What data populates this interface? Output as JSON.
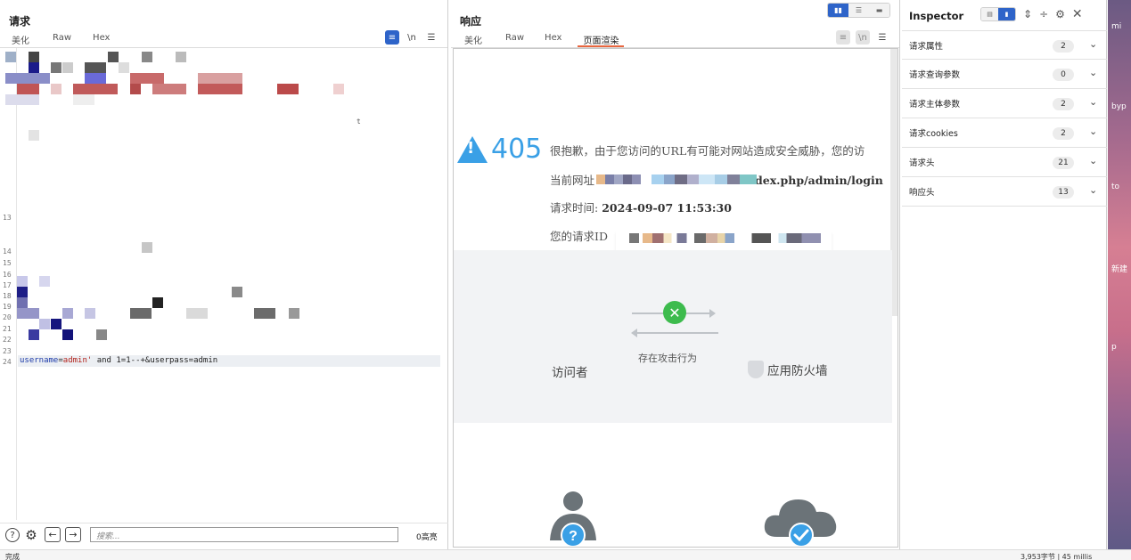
{
  "request": {
    "title": "请求",
    "tabs": [
      "美化",
      "Raw",
      "Hex"
    ],
    "icons": [
      "wrap-icon",
      "newline-icon",
      "menu-icon"
    ],
    "line_numbers": [
      "13",
      "14",
      "15",
      "16",
      "17",
      "18",
      "19",
      "20",
      "21",
      "22",
      "23",
      "24"
    ],
    "code": {
      "key": "username",
      "eq": "=",
      "value": "admin'",
      "rest": " and 1=1--+&userpass=admin",
      "stray_char": "t"
    },
    "footer": {
      "search_placeholder": "搜索...",
      "highlight_count": "0高亮"
    }
  },
  "response": {
    "title": "响应",
    "tabs": [
      "美化",
      "Raw",
      "Hex",
      "页面渲染"
    ],
    "active_tab": "页面渲染",
    "page": {
      "code": "405",
      "line1": "很抱歉，由于您访问的URL有可能对网站造成安全威胁，您的访",
      "line2_label": "当前网址",
      "line2_visible": "dex.php/admin/login",
      "line3_label": "请求时间: ",
      "line3_value": "2024-09-07 11:53:30",
      "line4_label": "您的请求ID",
      "visitor_label": "访问者",
      "attack_label": "存在攻击行为",
      "firewall_label": "应用防火墙"
    }
  },
  "inspector": {
    "title": "Inspector",
    "rows": [
      {
        "label": "请求属性",
        "count": "2"
      },
      {
        "label": "请求查询参数",
        "count": "0"
      },
      {
        "label": "请求主体参数",
        "count": "2"
      },
      {
        "label": "请求cookies",
        "count": "2"
      },
      {
        "label": "请求头",
        "count": "21"
      },
      {
        "label": "响应头",
        "count": "13"
      }
    ]
  },
  "desktop": {
    "labels": [
      "mi",
      "byp",
      "to",
      "新建",
      "p"
    ]
  },
  "status": {
    "left": "完成",
    "right": "3,953字节 | 45 millis"
  },
  "colors": {
    "accent_blue": "#2e64c9",
    "tab_underline": "#e8663f",
    "warning_blue": "#3aa0e6",
    "code_key": "#1c3aa9",
    "code_value": "#b1211a",
    "check_green": "#3dbb4d"
  }
}
